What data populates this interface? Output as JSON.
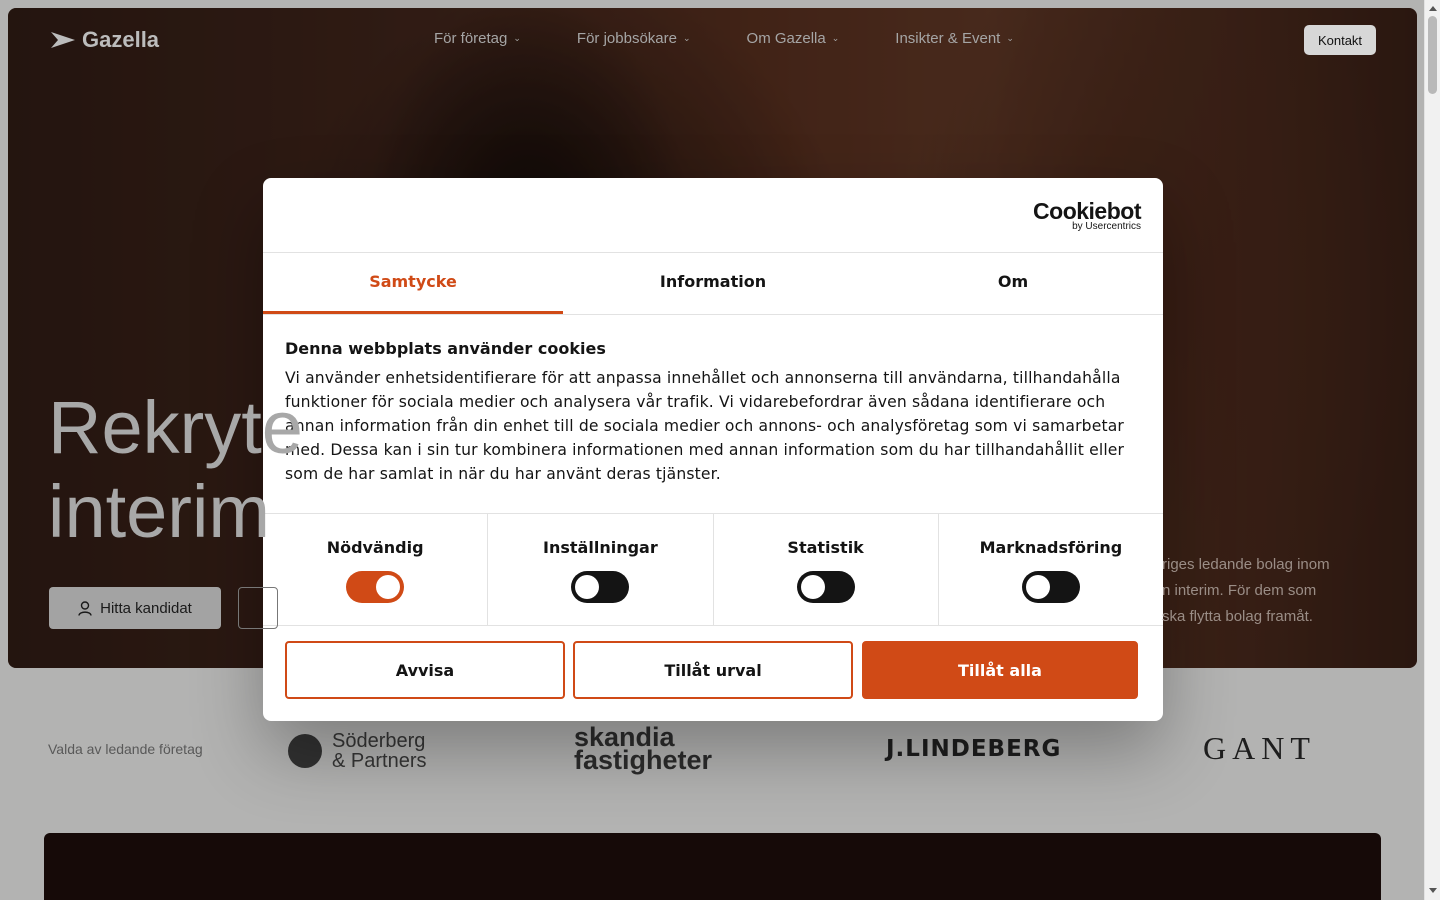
{
  "nav": {
    "logo": "Gazella",
    "links": [
      "För företag",
      "För jobbsökare",
      "Om Gazella",
      "Insikter & Event"
    ],
    "contact": "Kontakt"
  },
  "hero": {
    "title_line1": "Rekryte",
    "title_line2": "interim",
    "find_candidate": "Hitta kandidat",
    "text": "riges ledande bolag inom\nn interim. För dem som\nska flytta bolag framåt."
  },
  "partners": {
    "label": "Valda av ledande företag",
    "soderberg": [
      "Söderberg",
      "& Partners"
    ],
    "skandia": [
      "skandia",
      "fastigheter"
    ],
    "lindeberg": "J.LINDEBERG",
    "gant": "GANT"
  },
  "dialog": {
    "brand": "Cookiebot",
    "brand_sub": "by Usercentrics",
    "tabs": [
      "Samtycke",
      "Information",
      "Om"
    ],
    "title": "Denna webbplats använder cookies",
    "text": "Vi använder enhetsidentifierare för att anpassa innehållet och annonserna till användarna, tillhandahålla funktioner för sociala medier och analysera vår trafik. Vi vidarebefordrar även sådana identifierare och annan information från din enhet till de sociala medier och annons- och analysföretag som vi samarbetar med. Dessa kan i sin tur kombinera informationen med annan information som du har tillhandahållit eller som de har samlat in när du har använt deras tjänster.",
    "toggles": [
      {
        "label": "Nödvändig",
        "on": true
      },
      {
        "label": "Inställningar",
        "on": false
      },
      {
        "label": "Statistik",
        "on": false
      },
      {
        "label": "Marknadsföring",
        "on": false
      }
    ],
    "buttons": {
      "reject": "Avvisa",
      "allow_selection": "Tillåt urval",
      "allow_all": "Tillåt alla"
    }
  },
  "colors": {
    "accent": "#d04a16"
  }
}
